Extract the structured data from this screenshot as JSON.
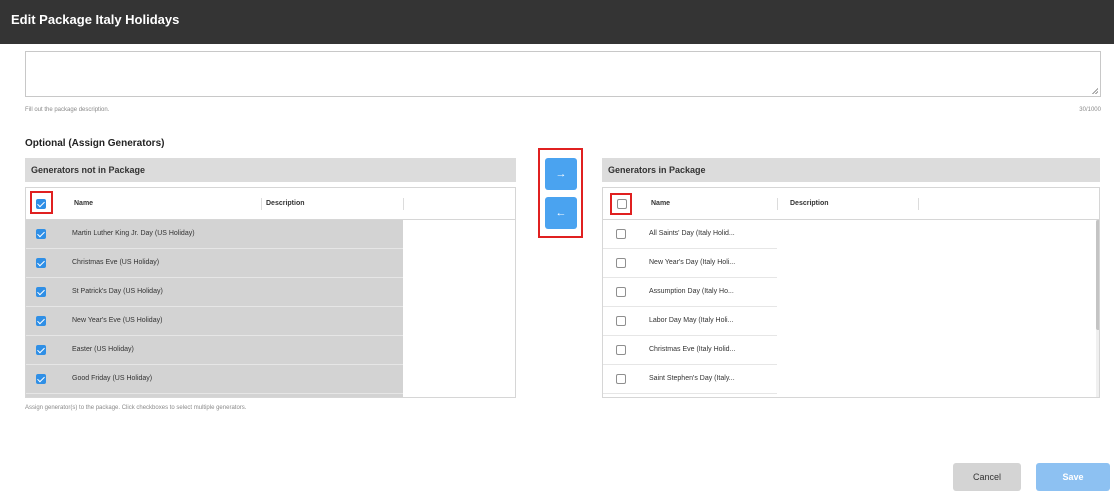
{
  "dialog": {
    "title": "Edit Package Italy Holidays"
  },
  "description": {
    "value": "",
    "helper": "Fill out the package description.",
    "counter": "30/1000"
  },
  "optional_title": "Optional (Assign Generators)",
  "left_panel": {
    "header": "Generators not in Package",
    "columns": [
      "Name",
      "Description"
    ],
    "select_all_checked": true,
    "rows": [
      {
        "name": "Martin Luther King Jr. Day (US Holiday)",
        "checked": true
      },
      {
        "name": "Christmas Eve (US Holiday)",
        "checked": true
      },
      {
        "name": "St Patrick's Day (US Holiday)",
        "checked": true
      },
      {
        "name": "New Year's Eve (US Holiday)",
        "checked": true
      },
      {
        "name": "Easter (US Holiday)",
        "checked": true
      },
      {
        "name": "Good Friday (US Holiday)",
        "checked": true
      }
    ]
  },
  "move_buttons": {
    "right": "→",
    "left": "←"
  },
  "assign_helper": "Assign generator(s) to the package. Click checkboxes to select multiple generators.",
  "right_panel": {
    "header": "Generators in Package",
    "columns": [
      "Name",
      "Description"
    ],
    "select_all_checked": false,
    "rows": [
      {
        "name": "All Saints' Day (Italy Holid...",
        "checked": false
      },
      {
        "name": "New Year's Day (Italy Holi...",
        "checked": false
      },
      {
        "name": "Assumption Day (Italy Ho...",
        "checked": false
      },
      {
        "name": "Labor Day May (Italy Holi...",
        "checked": false
      },
      {
        "name": "Christmas Eve (Italy Holid...",
        "checked": false
      },
      {
        "name": "Saint Stephen's Day (Italy...",
        "checked": false
      }
    ]
  },
  "footer": {
    "cancel": "Cancel",
    "save": "Save"
  },
  "colors": {
    "titlebar": "#343434",
    "accent": "#2f8fe6",
    "highlight": "#e02020",
    "save": "#8dc1f2"
  }
}
